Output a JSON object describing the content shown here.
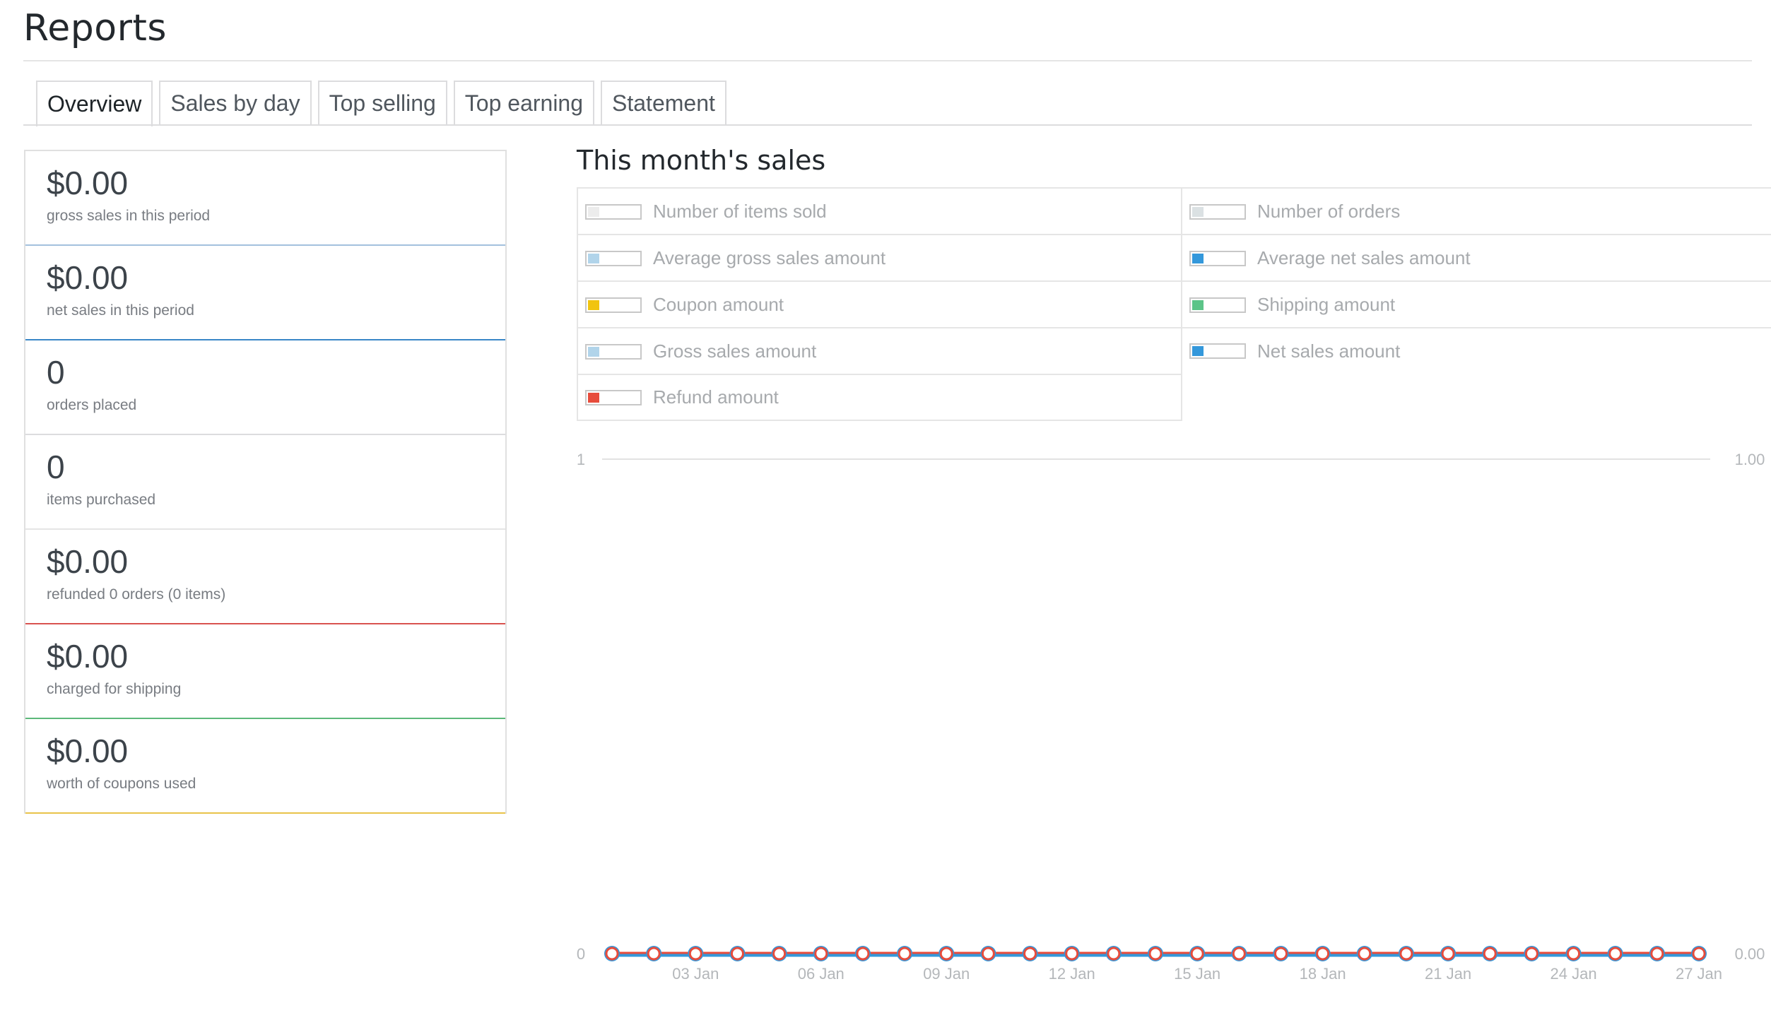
{
  "page": {
    "title": "Reports"
  },
  "tabs": [
    {
      "label": "Overview",
      "active": true
    },
    {
      "label": "Sales by day",
      "active": false
    },
    {
      "label": "Top selling",
      "active": false
    },
    {
      "label": "Top earning",
      "active": false
    },
    {
      "label": "Statement",
      "active": false
    }
  ],
  "stats": [
    {
      "amount": "$0.00",
      "description": "gross sales in this period",
      "accent": "#a3c1de"
    },
    {
      "amount": "$0.00",
      "description": "net sales in this period",
      "accent": "#3a87c8"
    },
    {
      "amount": "0",
      "description": "orders placed",
      "accent": "#dcdcde"
    },
    {
      "amount": "0",
      "description": "items purchased",
      "accent": "#e5e5e5"
    },
    {
      "amount": "$0.00",
      "description": "refunded 0 orders (0 items)",
      "accent": "#d9534f"
    },
    {
      "amount": "$0.00",
      "description": "charged for shipping",
      "accent": "#5cb87a"
    },
    {
      "amount": "$0.00",
      "description": "worth of coupons used",
      "accent": "#e8c34a"
    }
  ],
  "chart_title": "This month's sales",
  "legend": [
    {
      "label": "Number of items sold",
      "color": "#ececec"
    },
    {
      "label": "Number of orders",
      "color": "#dbe1e3"
    },
    {
      "label": "Average gross sales amount",
      "color": "#b1d4ea"
    },
    {
      "label": "Average net sales amount",
      "color": "#3498db"
    },
    {
      "label": "Coupon amount",
      "color": "#f1c40f"
    },
    {
      "label": "Shipping amount",
      "color": "#5cc488"
    },
    {
      "label": "Gross sales amount",
      "color": "#b1d4ea"
    },
    {
      "label": "Net sales amount",
      "color": "#3498db"
    },
    {
      "label": "Refund amount",
      "color": "#e74c3c"
    }
  ],
  "chart_data": {
    "type": "line",
    "title": "This month's sales",
    "x": [
      "01 Jan",
      "02 Jan",
      "03 Jan",
      "04 Jan",
      "05 Jan",
      "06 Jan",
      "07 Jan",
      "08 Jan",
      "09 Jan",
      "10 Jan",
      "11 Jan",
      "12 Jan",
      "13 Jan",
      "14 Jan",
      "15 Jan",
      "16 Jan",
      "17 Jan",
      "18 Jan",
      "19 Jan",
      "20 Jan",
      "21 Jan",
      "22 Jan",
      "23 Jan",
      "24 Jan",
      "25 Jan",
      "26 Jan",
      "27 Jan"
    ],
    "x_tick_labels": [
      "03 Jan",
      "06 Jan",
      "09 Jan",
      "12 Jan",
      "15 Jan",
      "18 Jan",
      "21 Jan",
      "24 Jan",
      "27 Jan"
    ],
    "y_left_ticks": [
      "0",
      "1"
    ],
    "y_right_ticks": [
      "0.00",
      "1.00"
    ],
    "ylim": [
      0,
      1
    ],
    "series": [
      {
        "name": "Net sales amount",
        "values": [
          0,
          0,
          0,
          0,
          0,
          0,
          0,
          0,
          0,
          0,
          0,
          0,
          0,
          0,
          0,
          0,
          0,
          0,
          0,
          0,
          0,
          0,
          0,
          0,
          0,
          0,
          0
        ]
      },
      {
        "name": "Refund amount",
        "values": [
          0,
          0,
          0,
          0,
          0,
          0,
          0,
          0,
          0,
          0,
          0,
          0,
          0,
          0,
          0,
          0,
          0,
          0,
          0,
          0,
          0,
          0,
          0,
          0,
          0,
          0,
          0
        ]
      }
    ],
    "grid": true
  }
}
